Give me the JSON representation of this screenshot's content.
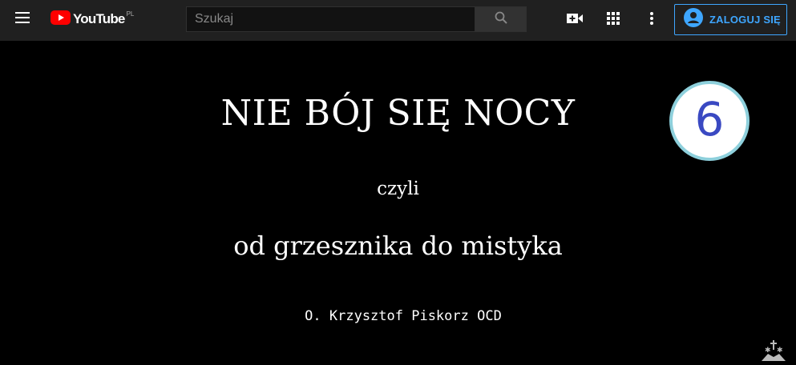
{
  "header": {
    "logo_text": "YouTube",
    "logo_country": "PL",
    "search": {
      "placeholder": "Szukaj",
      "value": ""
    },
    "signin_label": "ZALOGUJ SIĘ"
  },
  "video": {
    "title": "NIE BÓJ SIĘ NOCY",
    "subtitle_1": "czyli",
    "subtitle_2": "od grzesznika do mistyka",
    "author": "O. Krzysztof Piskorz OCD",
    "episode_number": "6"
  },
  "icons": {
    "menu": "hamburger-menu-icon",
    "logo": "youtube-play-icon",
    "search": "search-icon",
    "create": "video-camera-plus-icon",
    "apps": "apps-grid-icon",
    "more": "more-vertical-icon",
    "account": "account-circle-icon",
    "watermark": "crosses-watermark-icon"
  },
  "colors": {
    "topbar_bg": "#202020",
    "accent_blue": "#3ea6ff",
    "youtube_red": "#ff0000",
    "episode_number": "#3a49c2",
    "episode_ring": "#8ed0dc"
  }
}
